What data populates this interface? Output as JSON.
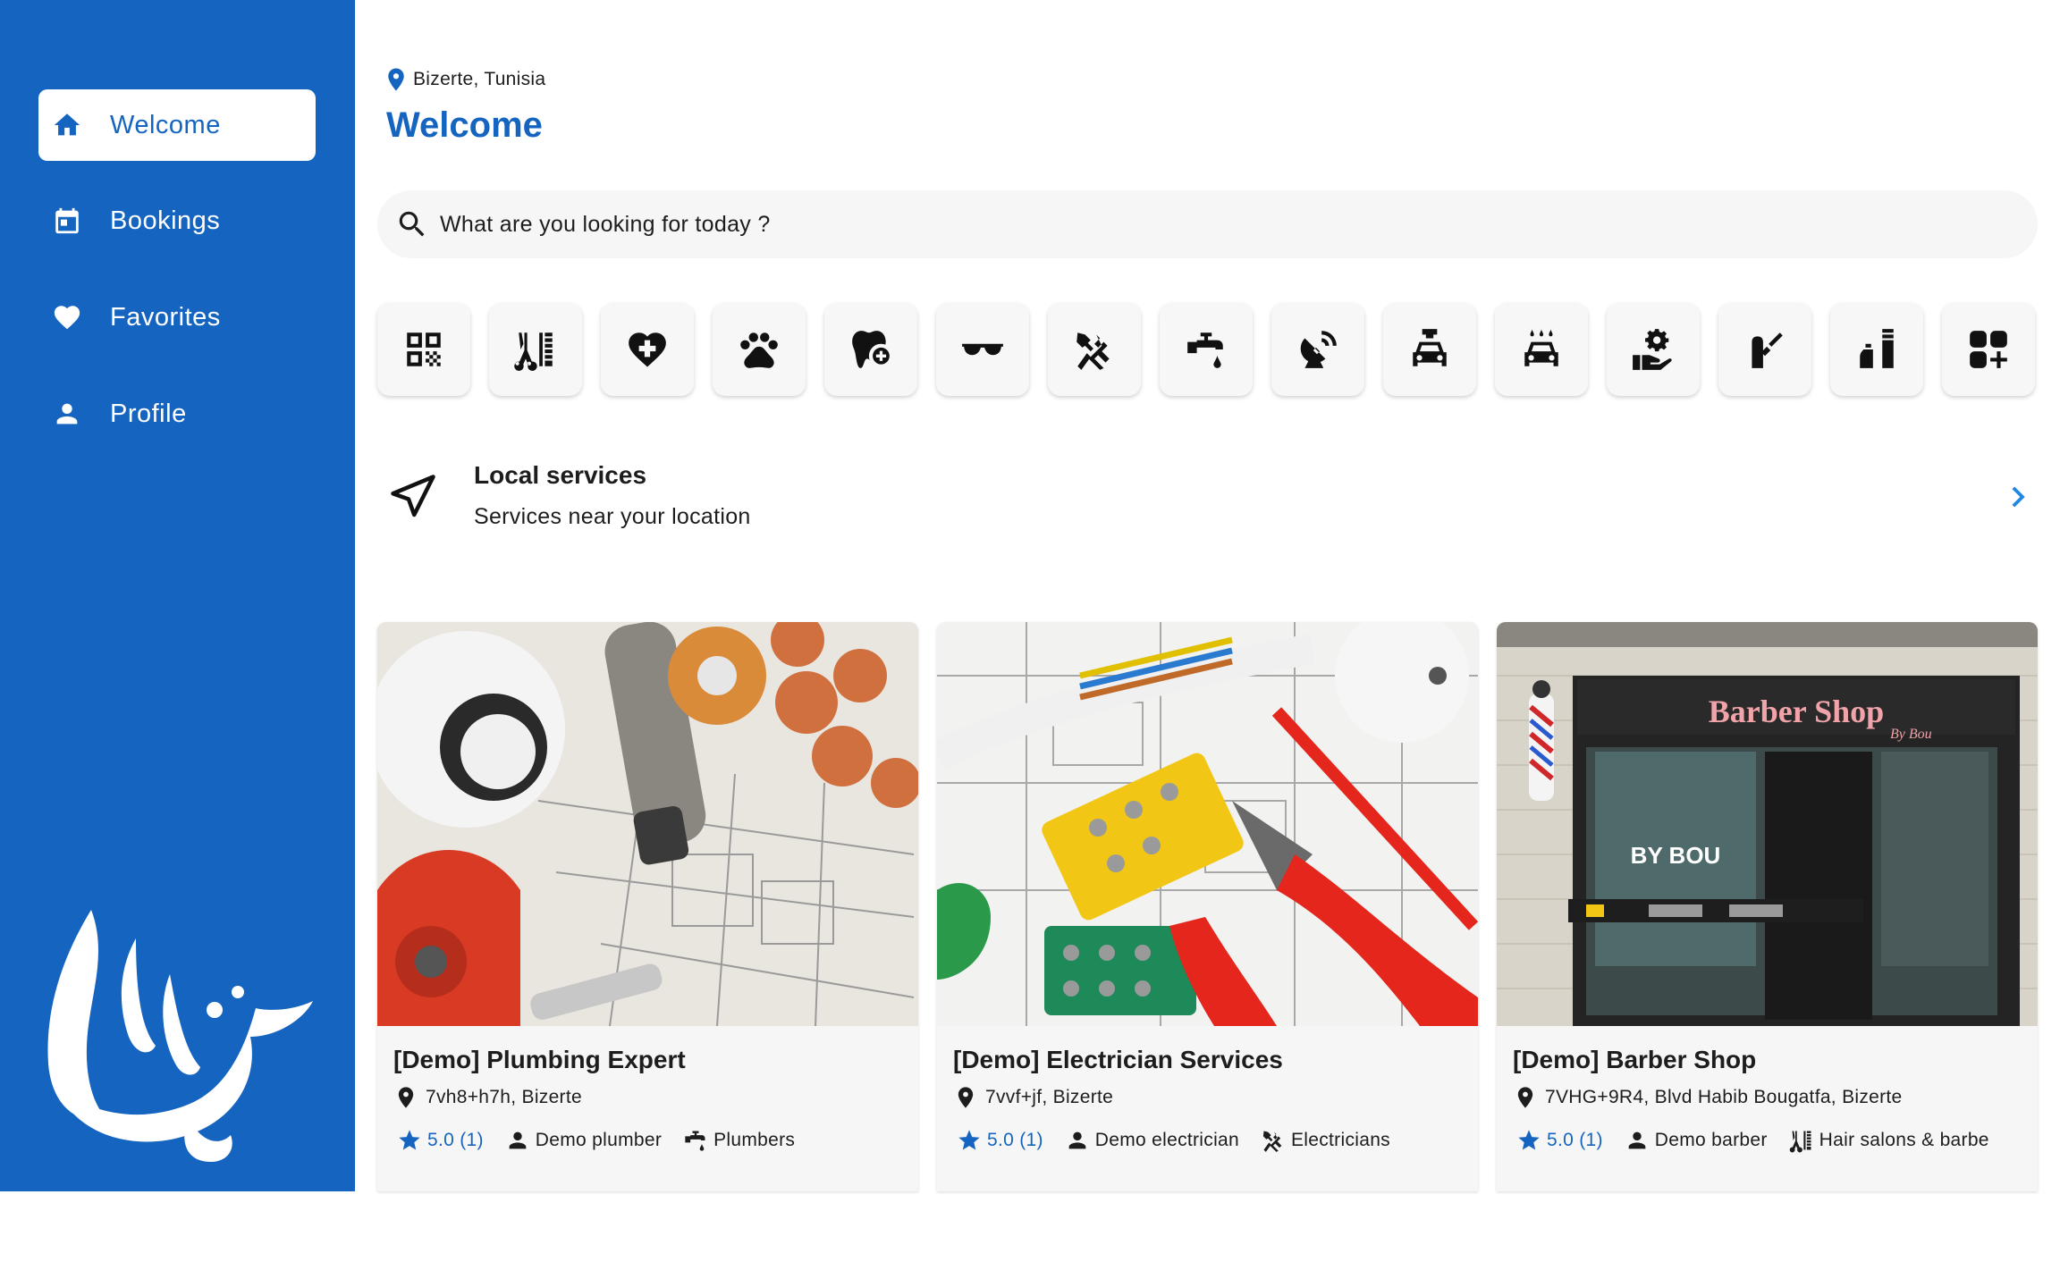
{
  "colors": {
    "primary": "#1565c0",
    "accent": "#1e88e5",
    "surface": "#f6f6f6"
  },
  "sidebar": {
    "items": [
      {
        "label": "Welcome",
        "icon": "home-icon",
        "active": true
      },
      {
        "label": "Bookings",
        "icon": "calendar-icon",
        "active": false
      },
      {
        "label": "Favorites",
        "icon": "heart-icon",
        "active": false
      },
      {
        "label": "Profile",
        "icon": "person-icon",
        "active": false
      }
    ],
    "logo": "marhaba-calligraphy-logo"
  },
  "header": {
    "location": "Bizerte, Tunisia",
    "title": "Welcome"
  },
  "search": {
    "placeholder": "What are you looking for today ?"
  },
  "categories": [
    "qr-code-icon",
    "barber-tools-icon",
    "medical-heart-icon",
    "paw-icon",
    "tooth-icon",
    "sunglasses-icon",
    "electric-tools-icon",
    "faucet-icon",
    "satellite-dish-icon",
    "car-repair-icon",
    "car-wash-icon",
    "hand-gear-icon",
    "nail-polish-icon",
    "cosmetics-icon",
    "more-categories-icon"
  ],
  "local_services": {
    "title": "Local services",
    "subtitle": "Services near your location"
  },
  "cards": [
    {
      "title": "[Demo] Plumbing Expert",
      "address": "7vh8+h7h, Bizerte",
      "rating": "5.0 (1)",
      "provider": "Demo plumber",
      "category": "Plumbers",
      "category_icon": "faucet-icon"
    },
    {
      "title": "[Demo] Electrician Services",
      "address": "7vvf+jf, Bizerte",
      "rating": "5.0 (1)",
      "provider": "Demo electrician",
      "category": "Electricians",
      "category_icon": "electric-tools-icon"
    },
    {
      "title": "[Demo] Barber Shop",
      "address": "7VHG+9R4, Blvd Habib Bougatfa, Bizerte",
      "rating": "5.0 (1)",
      "provider": "Demo barber",
      "category": "Hair salons & barbe",
      "category_icon": "barber-tools-icon",
      "sign": "Barber Shop",
      "sign_sub": "By Bou",
      "window_text": "BY BOU"
    }
  ]
}
